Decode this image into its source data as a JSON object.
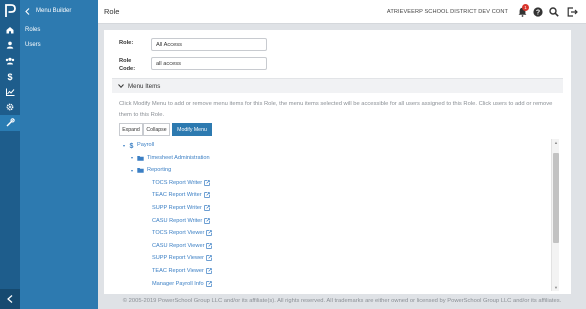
{
  "rail": {
    "icons": [
      "home-icon",
      "user-icon",
      "users-icon",
      "dollar-icon",
      "chart-icon",
      "gear-icon",
      "tools-icon"
    ],
    "active": "tools-icon"
  },
  "nav": {
    "title": "Menu Builder",
    "items": [
      {
        "label": "Roles"
      },
      {
        "label": "Users"
      }
    ]
  },
  "header": {
    "page_title": "Role",
    "district": "ATRIEVEERP SCHOOL DISTRICT DEV CONT",
    "notification_count": "1"
  },
  "form": {
    "role_label": "Role:",
    "role_value": "All Access",
    "code_label_1": "Role",
    "code_label_2": "Code:",
    "code_value": "all access"
  },
  "menu_items": {
    "section_title": "Menu Items",
    "help_text": "Click Modify Menu to add or remove menu items for this Role, the menu items selected will be accessible for all users assigned to this Role. Click users to add or remove them to this Role.",
    "expand_label": "Expand",
    "collapse_label": "Collapse",
    "modify_label": "Modify Menu",
    "tree": [
      {
        "label": "Payroll"
      },
      {
        "label": "Timesheet Administration"
      },
      {
        "label": "Reporting"
      },
      {
        "label": "TOCS Report Writer"
      },
      {
        "label": "TEAC Report Writer"
      },
      {
        "label": "SUPP Report Writer"
      },
      {
        "label": "CASU Report Writer"
      },
      {
        "label": "TOCS Report Viewer"
      },
      {
        "label": "CASU Report Viewer"
      },
      {
        "label": "SUPP Report Viewer"
      },
      {
        "label": "TEAC Report Viewer"
      },
      {
        "label": "Manager Payroll Info"
      }
    ]
  },
  "footer": {
    "text": "© 2005-2019 PowerSchool Group LLC and/or its affiliate(s). All rights reserved. All trademarks are either owned or licensed by PowerSchool Group LLC and/or its affiliates."
  },
  "colors": {
    "rail": "#1e5d8c",
    "nav": "#2d7ab0",
    "link": "#3b7fc4",
    "badge": "#d9342b"
  }
}
